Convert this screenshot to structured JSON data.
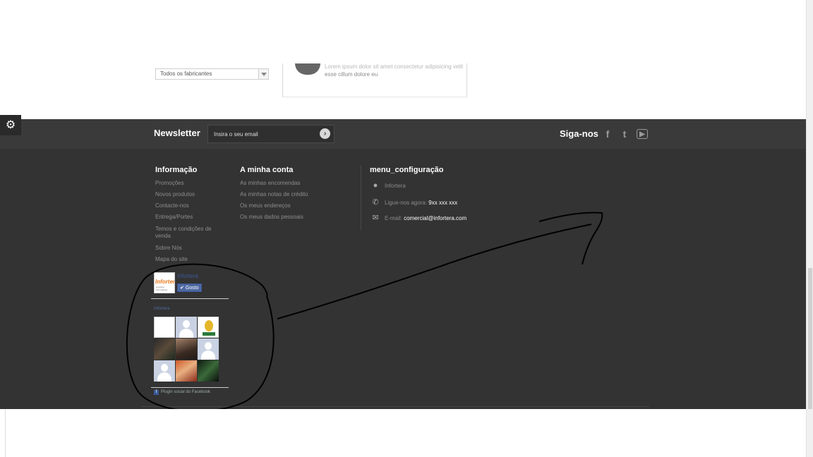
{
  "filter": {
    "manufacturer_label": "Todos os fabricantes",
    "blurb_line1": "Lorem ipsum dolor sit amet consectetur adipisicing velit",
    "blurb_line2": "esse cillum dolore eu"
  },
  "newsletter": {
    "title": "Newsletter",
    "placeholder": "Insira o seu email",
    "go_glyph": "›"
  },
  "follow": {
    "title": "Siga-nos",
    "icons": [
      "facebook-icon",
      "twitter-icon",
      "youtube-icon"
    ],
    "facebook_glyph": "f",
    "twitter_glyph": "t",
    "youtube_glyph": "▶"
  },
  "footer": {
    "info": {
      "title": "Informação",
      "links": [
        "Promoções",
        "Novos produtos",
        "Contacte-nos",
        "Entrega/Portes",
        "Temos e condições de venda",
        "Sobre Nós",
        "Mapa do site"
      ]
    },
    "account": {
      "title": "A minha conta",
      "links": [
        "As minhas encomendas",
        "As minhas notas de crédito",
        "Os meus endereços",
        "Os meus dados pessoais"
      ]
    },
    "config": {
      "title": "menu_configuração",
      "company": "Infortera",
      "phone_label": "Ligue-nos agora:",
      "phone_value": "9xx xxx xxx",
      "email_label": "E-mail:",
      "email_value": "comercial@infortera.com"
    }
  },
  "facebook": {
    "logo_text": "Infortera",
    "logo_sub": "soluções informáticas",
    "page_name": "Infortera",
    "like_label": "✔ Gosto",
    "page_link": "Infortera",
    "plugin_label": "Plugin social do Facebook",
    "fb_glyph": "f"
  },
  "colors": {
    "footer_bg": "#333333",
    "newsletter_bg": "#3a3a3a",
    "facebook_blue": "#3b5998"
  }
}
